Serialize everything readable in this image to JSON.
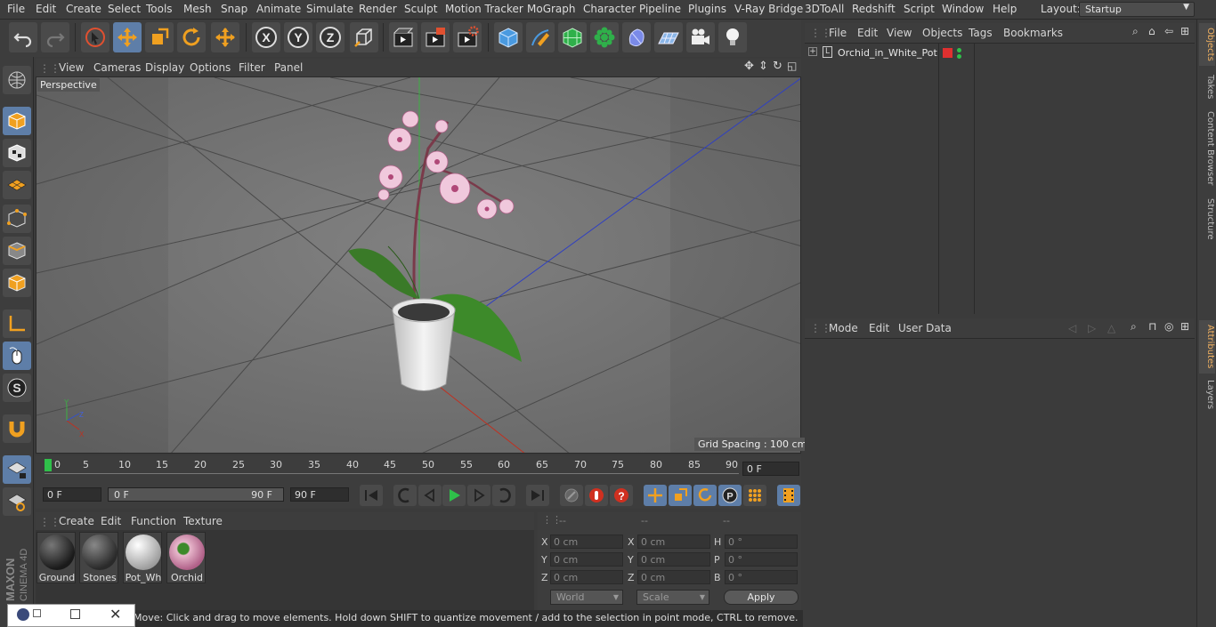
{
  "menubar": {
    "items": [
      "File",
      "Edit",
      "Create",
      "Select",
      "Tools",
      "Mesh",
      "Snap",
      "Animate",
      "Simulate",
      "Render",
      "Sculpt",
      "Motion Tracker",
      "MoGraph",
      "Character",
      "Pipeline",
      "Plugins",
      "V-Ray Bridge",
      "3DToAll",
      "Redshift",
      "Script",
      "Window",
      "Help"
    ],
    "layout_label": "Layout:",
    "layout_value": "Startup"
  },
  "toolbar": {
    "icons": [
      "undo-icon",
      "redo-icon",
      "live-selection-icon",
      "move-icon",
      "scale-icon",
      "rotate-icon",
      "move-mode-icon",
      "x-axis-icon",
      "y-axis-icon",
      "z-axis-icon",
      "world-coordinates-icon",
      "render-view-icon",
      "render-picture-viewer-icon",
      "edit-render-settings-icon",
      "cube-icon",
      "pen-icon",
      "subdivision-icon",
      "mograph-cloner-icon",
      "deformer-icon",
      "floor-icon",
      "camera-icon",
      "light-icon"
    ],
    "axis_labels": [
      "X",
      "Y",
      "Z"
    ]
  },
  "viewport": {
    "menu": [
      "View",
      "Cameras",
      "Display",
      "Options",
      "Filter",
      "Panel"
    ],
    "label": "Perspective",
    "grid_spacing": "Grid Spacing : 100 cm"
  },
  "timeline": {
    "ticks": [
      "0",
      "5",
      "10",
      "15",
      "20",
      "25",
      "30",
      "35",
      "40",
      "45",
      "50",
      "55",
      "60",
      "65",
      "70",
      "75",
      "80",
      "85",
      "90"
    ],
    "current_frame": "0 F"
  },
  "transport": {
    "start_field": "0 F",
    "range_start": "0 F",
    "range_end": "90 F",
    "end_field": "90 F"
  },
  "materials": {
    "menu": [
      "Create",
      "Edit",
      "Function",
      "Texture"
    ],
    "items": [
      {
        "name": "Ground",
        "color": "#3a3a3a"
      },
      {
        "name": "Stones",
        "color": "#4a4a4a"
      },
      {
        "name": "Pot_Wh",
        "color": "#d8d8d8"
      },
      {
        "name": "Orchid",
        "color": "#c890a8"
      }
    ]
  },
  "coordinates": {
    "headers": [
      "--",
      "--",
      "--"
    ],
    "rows": [
      {
        "a": "X",
        "av": "0 cm",
        "b": "X",
        "bv": "0 cm",
        "c": "H",
        "cv": "0 °"
      },
      {
        "a": "Y",
        "av": "0 cm",
        "b": "Y",
        "bv": "0 cm",
        "c": "P",
        "cv": "0 °"
      },
      {
        "a": "Z",
        "av": "0 cm",
        "b": "Z",
        "bv": "0 cm",
        "c": "B",
        "cv": "0 °"
      }
    ],
    "world": "World",
    "scale": "Scale",
    "apply": "Apply"
  },
  "status": "Move: Click and drag to move elements. Hold down SHIFT to quantize movement / add to the selection in point mode, CTRL to remove.",
  "objects": {
    "menu": [
      "File",
      "Edit",
      "View",
      "Objects",
      "Tags",
      "Bookmarks"
    ],
    "items": [
      {
        "name": "Orchid_in_White_Pot"
      }
    ]
  },
  "attributes": {
    "menu": [
      "Mode",
      "Edit",
      "User Data"
    ]
  },
  "right_tabs": [
    "Objects",
    "Takes",
    "Content Browser",
    "Structure",
    "Attributes",
    "Layers"
  ],
  "branding": {
    "line1": "MAXON",
    "line2": "CINEMA 4D"
  },
  "colors": {
    "accent": "#5e7ea8",
    "active_tab": "#f0b060",
    "playhead": "#2fc04a"
  }
}
